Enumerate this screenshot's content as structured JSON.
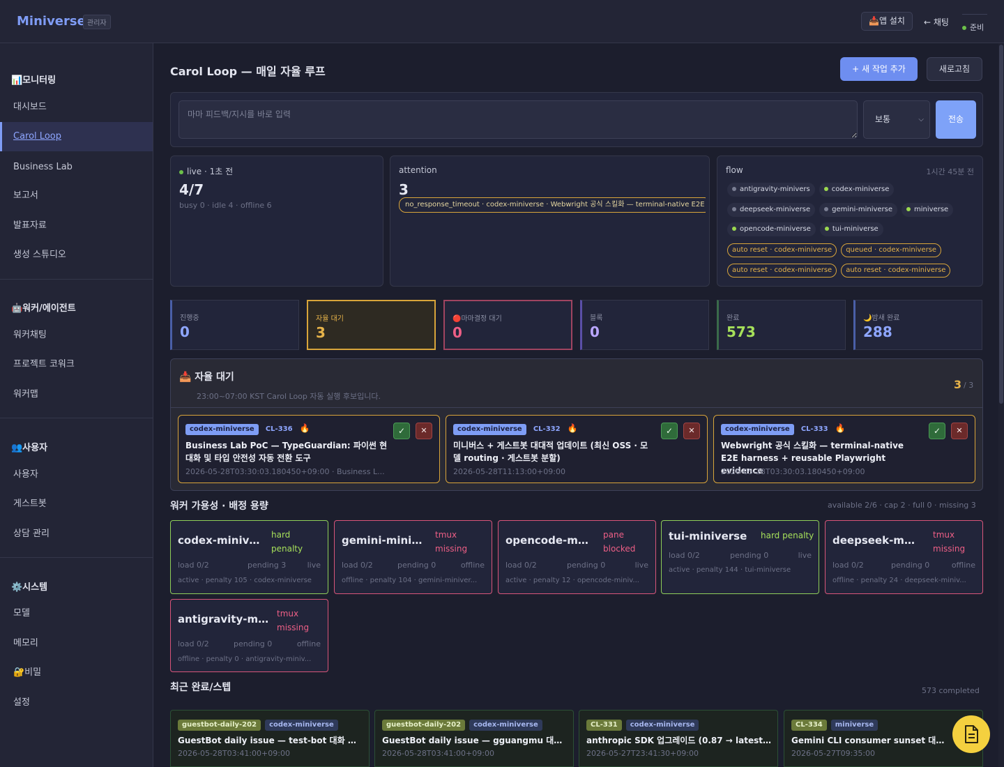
{
  "app": {
    "brand": "Miniverse",
    "role": "관리자"
  },
  "topbar": {
    "install_label": "📥앱 설치",
    "chat_label": "← 채팅",
    "status_label": "준비"
  },
  "sidebar": {
    "sections": [
      {
        "title": "📊모니터링",
        "items": [
          "대시보드",
          "Carol Loop",
          "Business Lab",
          "보고서",
          "발표자료",
          "생성 스튜디오"
        ]
      },
      {
        "title": "🤖워커/에이전트",
        "items": [
          "워커채팅",
          "프로젝트 코워크",
          "워커맵"
        ]
      },
      {
        "title": "👥사용자",
        "items": [
          "사용자",
          "게스트봇",
          "상담 관리"
        ]
      },
      {
        "title": "⚙️시스템",
        "items": [
          "모델",
          "메모리",
          "🔐비밀",
          "설정"
        ]
      }
    ],
    "active": "Carol Loop"
  },
  "header": {
    "title": "Carol Loop — 매일 자율 루프",
    "add_task": "+ 새 작업 추가",
    "refresh": "새로고침"
  },
  "feedback": {
    "placeholder": "마마 피드백/지시를 바로 입력",
    "priority": "보통",
    "send": "전송"
  },
  "live_panel": {
    "label": "live · 1초 전",
    "value": "4/7",
    "detail": "busy 0 · idle 4 · offline 6"
  },
  "attention_panel": {
    "label": "attention",
    "value": "3",
    "chip": "no_response_timeout · codex-miniverse · Webwright 공식 스킬화 — terminal-native E2E"
  },
  "flow_panel": {
    "label": "flow",
    "time": "1시간 45분 전",
    "chips_row1": [
      {
        "text": "antigravity-minivers",
        "dot": "grey"
      },
      {
        "text": "codex-miniverse",
        "dot": "lime"
      }
    ],
    "chips_row2": [
      {
        "text": "deepseek-miniverse",
        "dot": "grey"
      },
      {
        "text": "gemini-miniverse",
        "dot": "grey"
      },
      {
        "text": "miniverse",
        "dot": "lime"
      }
    ],
    "chips_row3": [
      {
        "text": "opencode-miniverse",
        "dot": "lime"
      },
      {
        "text": "tui-miniverse",
        "dot": "lime"
      }
    ],
    "chips_row4": [
      "auto reset · codex-miniverse",
      "queued · codex-miniverse"
    ],
    "chips_row5": [
      "auto reset · codex-miniverse",
      "auto reset · codex-miniverse"
    ]
  },
  "stats": [
    {
      "label": "진행중",
      "value": "0",
      "color": "#8ea6ff",
      "border": "#4a5fa8"
    },
    {
      "label": "자율 대기",
      "value": "3",
      "color": "#e6b34a",
      "border": "#d9a53a"
    },
    {
      "label": "🔴마마결정 대기",
      "value": "0",
      "color": "#ee5f86",
      "border": "#a04460"
    },
    {
      "label": "블록",
      "value": "0",
      "color": "#b9a6ff",
      "border": "#5a4fa8"
    },
    {
      "label": "완료",
      "value": "573",
      "color": "#a6e05a",
      "border": "#3a6a4a"
    },
    {
      "label": "🌙밤새 완료",
      "value": "288",
      "color": "#8ea6ff",
      "border": "#4a5fa8"
    }
  ],
  "auto_queue": {
    "title": "📥 자율 대기",
    "subtitle": "23:00~07:00 KST Carol Loop 자동 실행 후보입니다.",
    "count": "3",
    "cap": "/ 3",
    "tasks": [
      {
        "worker": "codex-miniverse",
        "id": "CL-336",
        "title": "Business Lab PoC — TypeGuardian: 파이썬 현대화 및 타입 안전성 자동 전환 도구",
        "meta": "2026-05-28T03:30:03.180450+09:00 · Business L..."
      },
      {
        "worker": "codex-miniverse",
        "id": "CL-332",
        "title": "미니버스 + 게스트봇 대대적 업데이트 (최신 OSS · 모델 routing · 게스트봇 분할)",
        "meta": "2026-05-28T11:13:00+09:00"
      },
      {
        "worker": "codex-miniverse",
        "id": "CL-333",
        "title": "Webwright 공식 스킬화 — terminal-native E2E harness + reusable Playwright evidence",
        "meta": "2026-05-28T03:30:03.180450+09:00"
      }
    ]
  },
  "workers_section": {
    "title": "워커 가용성 · 배정 용량",
    "summary": "available 2/6 · cap 2 · full 0 · missing 3"
  },
  "workers": [
    {
      "name": "codex-minive...",
      "badge": "hard\npenalty",
      "tone": "green",
      "load": "load 0/2",
      "pending": "pending 3",
      "state": "live",
      "foot": "active · penalty 105 · codex-miniverse"
    },
    {
      "name": "gemini-miniv...",
      "badge": "tmux\nmissing",
      "tone": "pink",
      "load": "load 0/2",
      "pending": "pending 0",
      "state": "offline",
      "foot": "offline · penalty 104 · gemini-miniver..."
    },
    {
      "name": "opencode-min...",
      "badge": "pane\nblocked",
      "tone": "pink",
      "load": "load 0/2",
      "pending": "pending 0",
      "state": "live",
      "foot": "active · penalty 12 · opencode-miniv..."
    },
    {
      "name": "tui-miniverse",
      "badge": "hard penalty",
      "tone": "green",
      "load": "load 0/2",
      "pending": "pending 0",
      "state": "live",
      "foot": "active · penalty 144 · tui-miniverse"
    },
    {
      "name": "deepseek-mini...",
      "badge": "tmux\nmissing",
      "tone": "pink",
      "load": "load 0/2",
      "pending": "pending 0",
      "state": "offline",
      "foot": "offline · penalty 24 · deepseek-miniv..."
    },
    {
      "name": "antigravity-min...",
      "badge": "tmux\nmissing",
      "tone": "pink",
      "load": "load 0/2",
      "pending": "pending 0",
      "state": "offline",
      "foot": "offline · penalty 0 · antigravity-miniv..."
    }
  ],
  "recent_section": {
    "title": "최근 완료/스텝",
    "summary": "573 completed"
  },
  "recent": [
    {
      "tag1": "guestbot-daily-202",
      "tag2": "codex-miniverse",
      "title": "GuestBot daily issue — test-bot 대화 실...",
      "date": "2026-05-28T03:41:00+09:00"
    },
    {
      "tag1": "guestbot-daily-202",
      "tag2": "codex-miniverse",
      "title": "GuestBot daily issue — gguangmu 대화...",
      "date": "2026-05-28T03:41:00+09:00"
    },
    {
      "tag1": "CL-331",
      "tag2": "codex-miniverse",
      "title": "anthropic SDK 업그레이드 (0.87 → latest...",
      "date": "2026-05-27T23:41:30+09:00"
    },
    {
      "tag1": "CL-334",
      "tag2": "miniverse",
      "title": "Gemini CLI consumer sunset 대응 —",
      "date": "2026-05-27T09:35:00"
    }
  ]
}
